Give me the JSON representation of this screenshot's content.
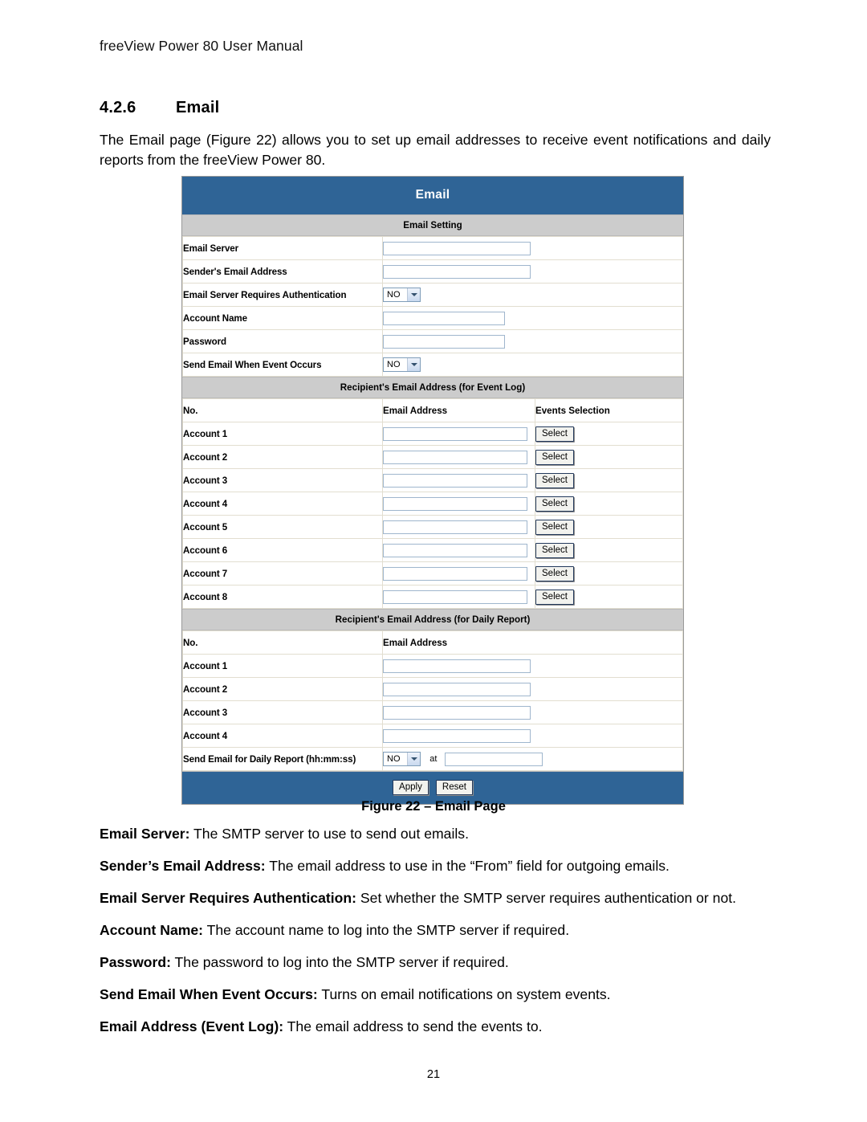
{
  "document": {
    "running_head": "freeView Power 80 User Manual",
    "section_number": "4.2.6",
    "section_title": "Email",
    "intro": "The Email page (Figure 22) allows you to set up email addresses to receive event notifications and daily reports from the freeView Power 80.",
    "figure_caption": "Figure 22 – Email Page",
    "page_number": "21"
  },
  "colors": {
    "header_blue": "#2f6496",
    "section_gray": "#cccccc",
    "input_border": "#9fb6cd",
    "button_border": "#23395c"
  },
  "figure": {
    "title": "Email",
    "email_setting": {
      "heading": "Email Setting",
      "rows": [
        {
          "label": "Email Server",
          "type": "text",
          "value": ""
        },
        {
          "label": "Sender's Email Address",
          "type": "text",
          "value": ""
        },
        {
          "label": "Email Server Requires Authentication",
          "type": "select",
          "value": "NO"
        },
        {
          "label": "Account Name",
          "type": "text",
          "value": ""
        },
        {
          "label": "Password",
          "type": "text",
          "value": ""
        },
        {
          "label": "Send Email When Event Occurs",
          "type": "select",
          "value": "NO"
        }
      ]
    },
    "event_log": {
      "heading": "Recipient's Email Address (for Event Log)",
      "columns": [
        "No.",
        "Email Address",
        "Events Selection"
      ],
      "select_button_label": "Select",
      "rows": [
        {
          "no": "Account 1",
          "email": ""
        },
        {
          "no": "Account 2",
          "email": ""
        },
        {
          "no": "Account 3",
          "email": ""
        },
        {
          "no": "Account 4",
          "email": ""
        },
        {
          "no": "Account 5",
          "email": ""
        },
        {
          "no": "Account 6",
          "email": ""
        },
        {
          "no": "Account 7",
          "email": ""
        },
        {
          "no": "Account 8",
          "email": ""
        }
      ]
    },
    "daily_report": {
      "heading": "Recipient's Email Address (for Daily Report)",
      "columns": [
        "No.",
        "Email Address"
      ],
      "rows": [
        {
          "no": "Account 1",
          "email": ""
        },
        {
          "no": "Account 2",
          "email": ""
        },
        {
          "no": "Account 3",
          "email": ""
        },
        {
          "no": "Account 4",
          "email": ""
        }
      ],
      "schedule": {
        "label": "Send Email for Daily Report (hh:mm:ss)",
        "enabled_value": "NO",
        "at_label": "at",
        "time_value": ""
      }
    },
    "actions": {
      "apply_label": "Apply",
      "reset_label": "Reset"
    }
  },
  "definitions": [
    {
      "term": "Email Server:",
      "text": " The SMTP server to use to send out emails."
    },
    {
      "term": "Sender’s Email Address:",
      "text": " The email address to use in the “From” field for outgoing emails."
    },
    {
      "term": "Email Server Requires Authentication:",
      "text": " Set whether the SMTP server requires authentication or not."
    },
    {
      "term": "Account Name:",
      "text": " The account name to log into the SMTP server if required."
    },
    {
      "term": "Password:",
      "text": " The password to log into the SMTP server if required."
    },
    {
      "term": "Send Email When Event Occurs:",
      "text": " Turns on email notifications on system events."
    },
    {
      "term": "Email Address (Event Log):",
      "text": " The email address to send the events to."
    }
  ]
}
